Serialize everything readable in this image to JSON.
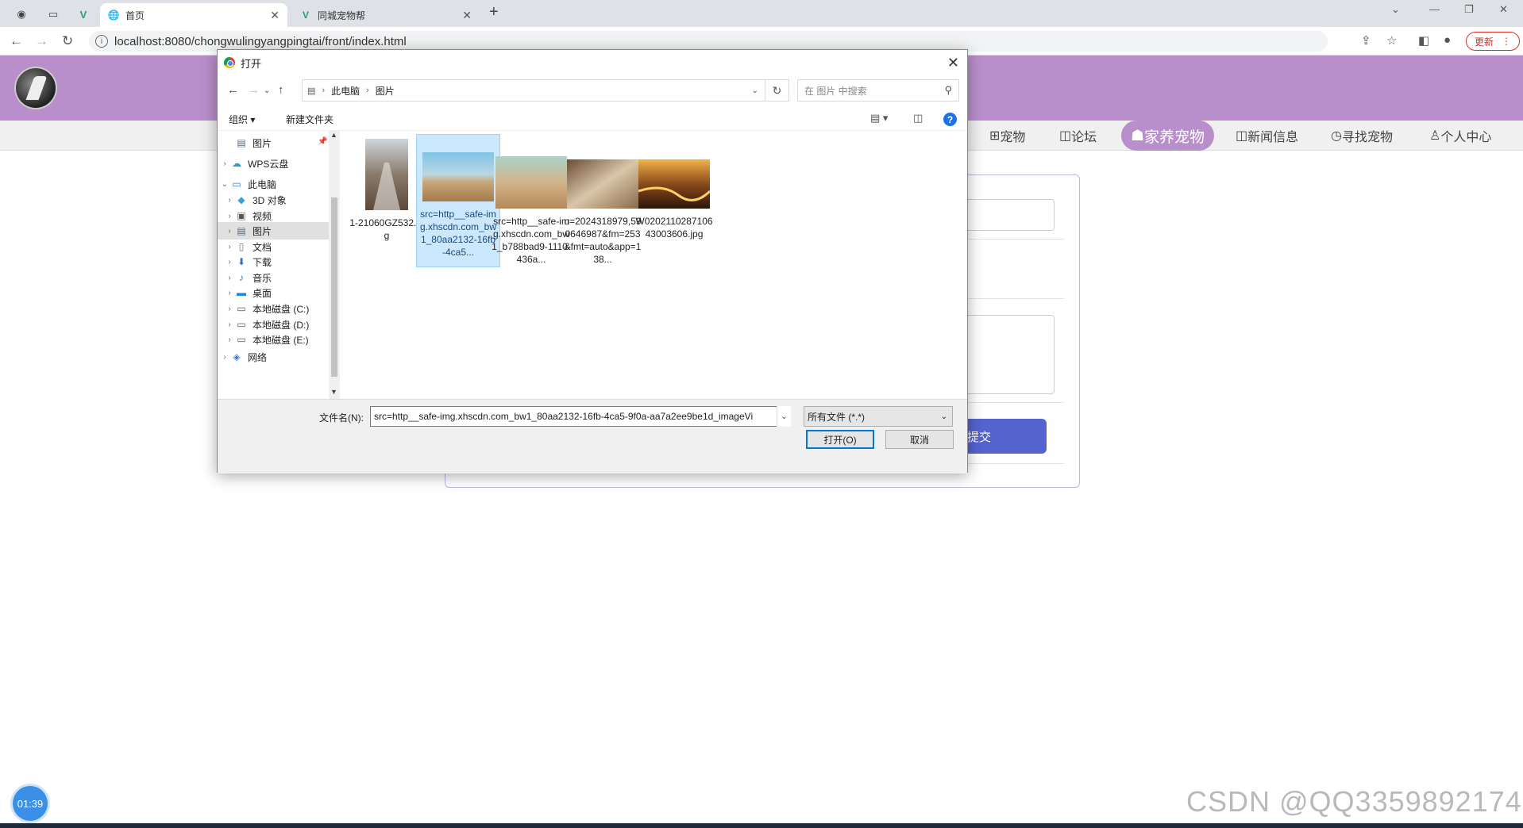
{
  "browser": {
    "tabs": [
      {
        "title": "首页",
        "icon": "globe-icon",
        "active": true
      },
      {
        "title": "同城宠物帮",
        "icon": "vue-logo-icon",
        "active": false
      }
    ],
    "url": "localhost:8080/chongwulingyangpingtai/front/index.html",
    "update_label": "更新"
  },
  "site": {
    "nav_items": [
      "宠物",
      "论坛",
      "家养宠物",
      "新闻信息",
      "寻找宠物",
      "个人中心"
    ],
    "active_nav": "家养宠物",
    "submit_label": "提交",
    "accent_color": "#b98fcb",
    "button_color": "#5563cf"
  },
  "dialog": {
    "title": "打开",
    "breadcrumb": [
      "此电脑",
      "图片"
    ],
    "search_placeholder": "在 图片 中搜索",
    "toolbar": {
      "organize": "组织",
      "new_folder": "新建文件夹"
    },
    "sidebar": [
      {
        "label": "图片",
        "icon": "pictures-icon",
        "indent": 1,
        "selected": false
      },
      {
        "label": "WPS云盘",
        "icon": "cloud-icon",
        "indent": 0,
        "selected": false
      },
      {
        "label": "此电脑",
        "icon": "computer-icon",
        "indent": 0,
        "selected": false
      },
      {
        "label": "3D 对象",
        "icon": "cube-icon",
        "indent": 1,
        "selected": false
      },
      {
        "label": "视频",
        "icon": "video-icon",
        "indent": 1,
        "selected": false
      },
      {
        "label": "图片",
        "icon": "pictures-icon",
        "indent": 1,
        "selected": true
      },
      {
        "label": "文档",
        "icon": "document-icon",
        "indent": 1,
        "selected": false
      },
      {
        "label": "下载",
        "icon": "download-icon",
        "indent": 1,
        "selected": false
      },
      {
        "label": "音乐",
        "icon": "music-icon",
        "indent": 1,
        "selected": false
      },
      {
        "label": "桌面",
        "icon": "desktop-icon",
        "indent": 1,
        "selected": false
      },
      {
        "label": "本地磁盘 (C:)",
        "icon": "drive-icon",
        "indent": 1,
        "selected": false
      },
      {
        "label": "本地磁盘 (D:)",
        "icon": "drive-icon",
        "indent": 1,
        "selected": false
      },
      {
        "label": "本地磁盘 (E:)",
        "icon": "drive-icon",
        "indent": 1,
        "selected": false
      },
      {
        "label": "网络",
        "icon": "network-icon",
        "indent": 0,
        "selected": false
      }
    ],
    "files": [
      {
        "name": "1-21060GZ532.jpg",
        "selected": false
      },
      {
        "name": "src=http__safe-img.xhscdn.com_bw1_80aa2132-16fb-4ca5...",
        "selected": true
      },
      {
        "name": "src=http__safe-img.xhscdn.com_bw1_b788bad9-1110-436a...",
        "selected": false
      },
      {
        "name": "u=2024318979,590646987&fm=253&fmt=auto&app=138...",
        "selected": false
      },
      {
        "name": "W020211028710643003606.jpg",
        "selected": false
      }
    ],
    "filename_label": "文件名(N):",
    "filename_value": "src=http__safe-img.xhscdn.com_bw1_80aa2132-16fb-4ca5-9f0a-aa7a2ee9be1d_imageVi",
    "filter_value": "所有文件 (*.*)",
    "open_label": "打开(O)",
    "cancel_label": "取消"
  },
  "overlay": {
    "timer": "01:39",
    "watermark": "CSDN @QQ3359892174"
  }
}
